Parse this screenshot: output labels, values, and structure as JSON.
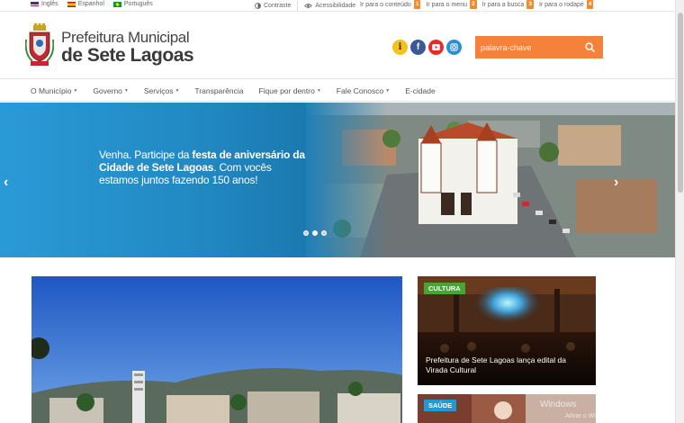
{
  "topbar": {
    "languages": [
      {
        "label": "Inglês",
        "flag": "us-flag"
      },
      {
        "label": "Espanhol",
        "flag": "es-flag"
      },
      {
        "label": "Português",
        "flag": "br-flag"
      }
    ],
    "contrast_label": "Contraste",
    "accessibility_label": "Acessibilidade",
    "skip_links": [
      {
        "label": "Ir para o conteúdo",
        "key": "1"
      },
      {
        "label": "Ir para o menu",
        "key": "2"
      },
      {
        "label": "Ir para a busca",
        "key": "3"
      },
      {
        "label": "Ir para o rodapé",
        "key": "4"
      }
    ]
  },
  "header": {
    "brand_line1": "Prefeitura Municipal",
    "brand_line2": "de Sete Lagoas",
    "search_placeholder": "palavra-chave",
    "social_icons": [
      "info-icon",
      "facebook-icon",
      "youtube-icon",
      "instagram-icon"
    ],
    "info_glyph": "i",
    "facebook_glyph": "f"
  },
  "nav": {
    "items": [
      {
        "label": "O Município",
        "dropdown": true
      },
      {
        "label": "Governo",
        "dropdown": true
      },
      {
        "label": "Serviços",
        "dropdown": true
      },
      {
        "label": "Transparência",
        "dropdown": false
      },
      {
        "label": "Fique por dentro",
        "dropdown": true
      },
      {
        "label": "Fale Conosco",
        "dropdown": true
      },
      {
        "label": "E-cidade",
        "dropdown": false
      }
    ]
  },
  "slider": {
    "text_part1": "Venha. Participe da ",
    "text_bold": "festa de aniversário da Cidade de Sete Lagoas",
    "text_part2": ". Com vocês estamos juntos fazendo 150 anos!",
    "slide_count": 3,
    "active_slide": 2,
    "prev_glyph": "‹",
    "next_glyph": "›"
  },
  "cards": [
    {
      "tag": "CULTURA",
      "title": "Prefeitura de Sete Lagoas lança edital da Virada Cultural"
    },
    {
      "tag": "SAÚDE",
      "title": ""
    }
  ],
  "os_watermark": {
    "line1": "Windows",
    "line2": "Ativar o Windows"
  },
  "colors": {
    "accent_orange": "#f5823a",
    "slider_blue": "#2188c2",
    "tag_cultura": "#43a832",
    "tag_saude": "#1e9bd7"
  }
}
